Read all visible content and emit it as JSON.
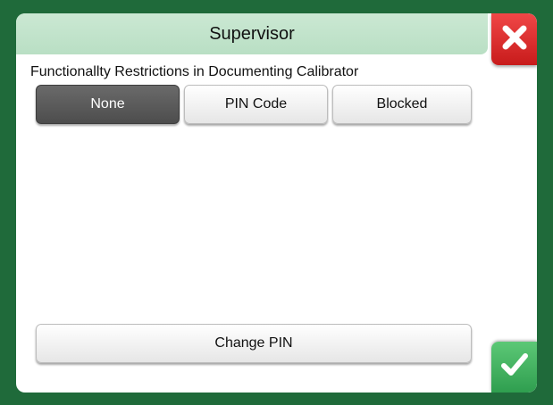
{
  "header": {
    "title": "Supervisor"
  },
  "section": {
    "label": "Functionallty Restrictions in Documenting Calibrator"
  },
  "options": [
    {
      "label": "None",
      "selected": true
    },
    {
      "label": "PIN Code",
      "selected": false
    },
    {
      "label": "Blocked",
      "selected": false
    }
  ],
  "actions": {
    "change_pin_label": "Change PIN"
  },
  "icons": {
    "close": "close-icon",
    "confirm": "checkmark-icon"
  },
  "colors": {
    "header": "#c4e4cc",
    "close": "#e03030",
    "confirm": "#3fb35f",
    "frame": "#1f6a3a",
    "selected": "#5a5a5a"
  }
}
